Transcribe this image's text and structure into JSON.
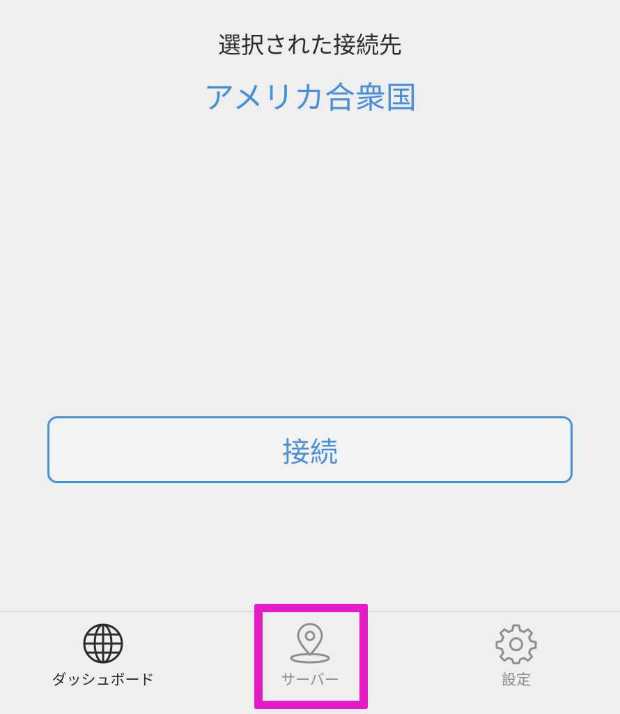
{
  "header": {
    "label": "選択された接続先",
    "destination": "アメリカ合衆国"
  },
  "main": {
    "connect_button_label": "接続"
  },
  "tab_bar": {
    "tabs": [
      {
        "label": "ダッシュボード",
        "icon": "globe-icon"
      },
      {
        "label": "サーバー",
        "icon": "location-pin-icon"
      },
      {
        "label": "設定",
        "icon": "gear-icon"
      }
    ]
  },
  "colors": {
    "accent": "#4a90d9",
    "background": "#efeff0",
    "highlight": "#e51bc6",
    "inactive": "#8e8e93"
  }
}
